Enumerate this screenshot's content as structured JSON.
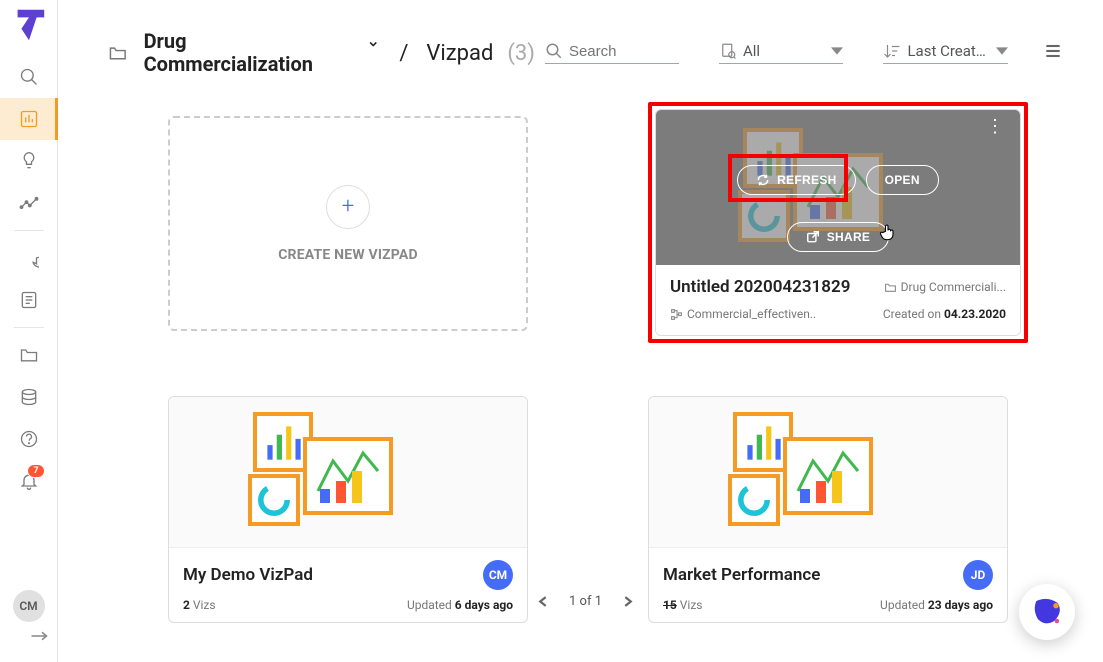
{
  "sidebar": {
    "user_initials": "CM",
    "notification_count": "7"
  },
  "header": {
    "project_name": "Drug Commercialization",
    "crumb": "Vizpad",
    "crumb_count": "(3)",
    "search_placeholder": "Search",
    "filter_label": "All",
    "sort_label": "Last Creat…"
  },
  "create": {
    "label": "CREATE NEW VIZPAD"
  },
  "hover_card": {
    "refresh": "REFRESH",
    "open": "OPEN",
    "share": "SHARE",
    "name": "Untitled 202004231829",
    "folder": "Drug Commerciali...",
    "dataset": "Commercial_effectiven..",
    "created_prefix": "Created on ",
    "created_date": "04.23.2020"
  },
  "cards": [
    {
      "title": "My Demo VizPad",
      "count": "2",
      "count_label": "Vizs",
      "updated_prefix": "Updated ",
      "updated_ago": "6 days ago",
      "initials": "CM",
      "color": "#446cf6"
    },
    {
      "title": "Market Performance",
      "count": "15",
      "count_label": "Vizs",
      "updated_prefix": "Updated ",
      "updated_ago": "23 days ago",
      "initials": "JD",
      "color": "#446cf6"
    }
  ],
  "pagination": {
    "label": "1 of 1"
  }
}
